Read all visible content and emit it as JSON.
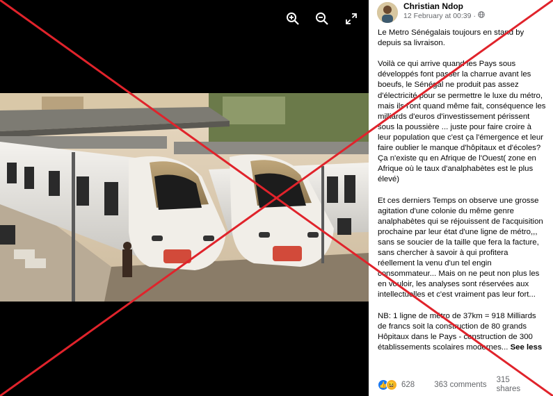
{
  "post": {
    "author": "Christian Ndop",
    "timestamp": "12 February at 00:39",
    "privacy_icon": "globe-icon",
    "paragraphs": [
      "Le Metro Sénégalais toujours en stand by depuis sa livraison.",
      "Voilà ce qui arrive quand les Pays sous développés font passer la charrue avant les boeufs, le Sénégal ne produit pas assez d'électricité pour se permettre le luxe du métro, mais ils l'ont quand même fait, conséquence les milliards d'euros d'investissement périssent sous la poussière ... juste pour faire croire à leur population que c'est ça l'émergence et leur faire oublier le manque d'hôpitaux et d'écoles? Ça n'existe qu en Afrique de l'Ouest( zone en Afrique où le taux d'analphabètes est le plus élevé)",
      "Et ces derniers Temps on observe une grosse agitation d'une colonie du même genre analphabètes qui se réjouissent de l'acquisition prochaine par leur état d'une ligne de métro,,, sans se soucier de la taille que fera la facture, sans chercher à savoir à qui profitera réellement la venu d'un tel engin consommateur... Mais on ne peut non plus les en vouloir, les analyses sont réservées aux intellectuelles et c'est vraiment pas leur fort...",
      "NB: 1 ligne de métro de 37km = 918 Milliards de francs soit la construction de 80 grands Hôpitaux dans le Pays - construction de 300 établissements scolaires modernes..."
    ],
    "see_more": "See less"
  },
  "engagement": {
    "reactions_count": "628",
    "comments": "363 comments",
    "shares": "315 shares"
  },
  "viewer": {
    "tools": [
      "zoom-in-icon",
      "zoom-out-icon",
      "fullscreen-icon"
    ]
  },
  "colors": {
    "overlay_cross": "#e0232b",
    "like_blue": "#1877f2",
    "haha_yellow": "#f7b125"
  }
}
